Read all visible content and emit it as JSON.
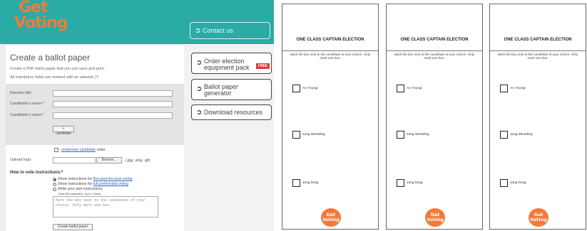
{
  "header": {
    "logo_line1": "Get",
    "logo_line2": "Voting",
    "colors": {
      "header_bg": "#2aaba6",
      "logo": "#f07a3c"
    }
  },
  "form": {
    "title": "Create a ballot paper",
    "intro": "Create a PDF ballot paper that you can save and print.",
    "mandatory_note": "All mandatory fields are marked with an asterisk (*)",
    "election_title_label": "Election title:",
    "candidate1_label": "Candidate's name:*",
    "candidate2_label": "Candidate's name:*",
    "add_candidate_button": "+ candidate",
    "randomise_link": "randomise candidate",
    "randomise_suffix": "order",
    "upload_logo_label": "Upload logo:",
    "browse_button": "Browse...",
    "file_types": "(.jpg, .png, .gif)",
    "how_to_vote_title": "How to vote instructions:*",
    "options": [
      {
        "prefix": "Show instructions for",
        "link": "first past the post voting",
        "checked": true
      },
      {
        "prefix": "Show instructions for",
        "link": "full preferential voting",
        "checked": false
      },
      {
        "prefix": "Write your own instructions:",
        "link": "",
        "checked": false
      }
    ],
    "char_limit_note": "(Max 88 characters, up to 2 lines)",
    "custom_instructions_placeholder": "Mark the box next to the candidate of your choice. Only mark one box.",
    "create_button": "Create ballot paper"
  },
  "nav": {
    "contact": "Contact us",
    "order_line1": "Order election",
    "order_line2": "equipment pack",
    "free_badge": "FREE",
    "ballot_line1": "Ballot paper",
    "ballot_line2": "generator",
    "download": "Download resources",
    "arrow_icon": "circle-arrow-icon"
  },
  "ballots": [
    {
      "title": "ONE CLASS CAPTAIN ELECTION",
      "instructions": "Mark the box next to the candidate of your choice. Only mark one box.",
      "candidates": [
        "An Youngi",
        "Jang Wintefieg",
        "Jang Dwig"
      ],
      "logo_line1": "Get",
      "logo_line2": "Voting"
    },
    {
      "title": "ONE CLASS CAPTAIN ELECTION",
      "instructions": "Mark the box next to the candidate of your choice. Only mark one box.",
      "candidates": [
        "An Youngi",
        "Jang Wintefieg",
        "Jang Dwig"
      ],
      "logo_line1": "Get",
      "logo_line2": "Voting"
    },
    {
      "title": "ONE CLASS CAPTAIN ELECTION",
      "instructions": "Mark the box next to the candidate of your choice. Only mark one box.",
      "candidates": [
        "An Youngi",
        "Jang Wintefieg",
        "Jang Dwig"
      ],
      "logo_line1": "Get",
      "logo_line2": "Voting"
    }
  ]
}
